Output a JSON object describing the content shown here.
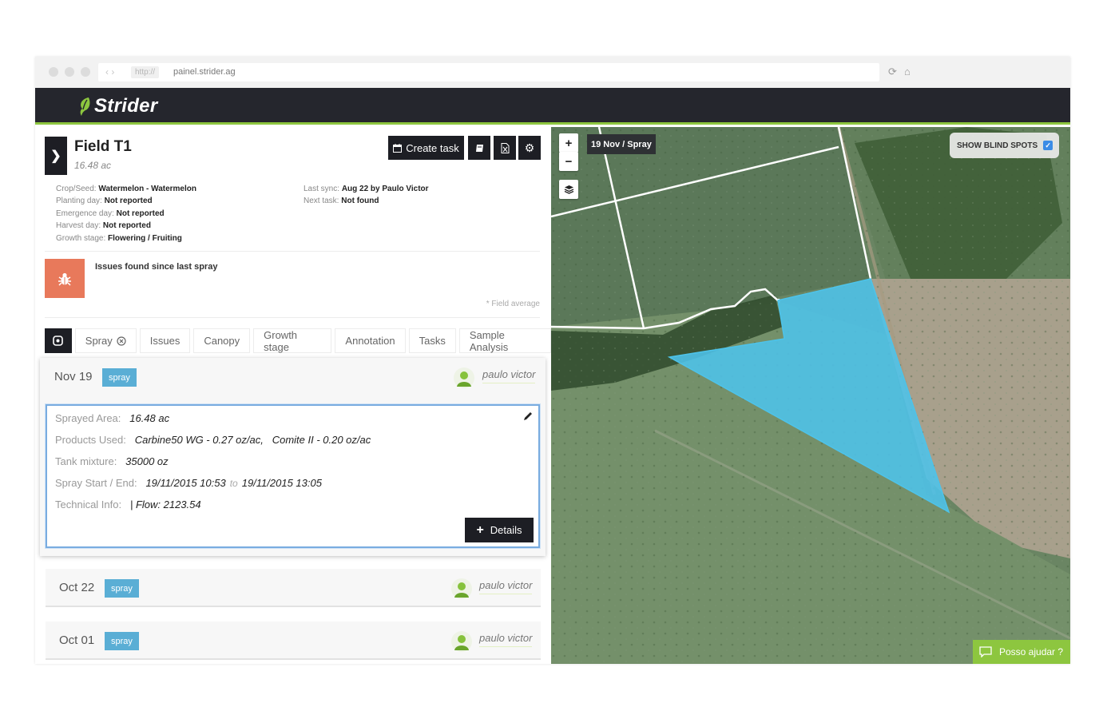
{
  "browser": {
    "url_protocol": "http://",
    "url": "painel.strider.ag"
  },
  "app": {
    "brand": "Strider",
    "brand_color": "#8dc63f",
    "dark": "#1d1e24"
  },
  "field": {
    "title": "Field T1",
    "area": "16.48 ac",
    "toolbar": {
      "create_task_label": "Create task",
      "icons": [
        "calendar-icon",
        "book-icon",
        "excel-icon",
        "gear-icon"
      ]
    },
    "info_left": [
      {
        "label": "Crop/Seed:",
        "value": "Watermelon - Watermelon",
        "status": "normal"
      },
      {
        "label": "Planting day:",
        "value": "Not reported",
        "status": "missing"
      },
      {
        "label": "Emergence day:",
        "value": "Not reported",
        "status": "missing"
      },
      {
        "label": "Harvest day:",
        "value": "Not reported",
        "status": "missing"
      },
      {
        "label": "Growth stage:",
        "value": "Flowering / Fruiting",
        "status": "normal"
      }
    ],
    "info_right": [
      {
        "label": "Last sync:",
        "value": "Aug 22 by Paulo Victor"
      },
      {
        "label": "Next task:",
        "value": "Not found"
      }
    ],
    "issues_title": "Issues found since last spray",
    "field_average_note": "* Field average"
  },
  "tabs": [
    {
      "label": "Spray",
      "active": true,
      "closable": true
    },
    {
      "label": "Issues"
    },
    {
      "label": "Canopy"
    },
    {
      "label": "Growth stage"
    },
    {
      "label": "Annotation"
    },
    {
      "label": "Tasks"
    },
    {
      "label": "Sample Analysis"
    }
  ],
  "events": [
    {
      "date": "Nov 19",
      "tag": "spray",
      "user": "paulo victor",
      "details": {
        "sprayed_area_label": "Sprayed Area:",
        "sprayed_area": "16.48 ac",
        "products_label": "Products Used:",
        "product_1": "Carbine50 WG - 0.27 oz/ac,",
        "product_2": "Comite II - 0.20 oz/ac",
        "tank_label": "Tank mixture:",
        "tank": "35000 oz",
        "spray_label": "Spray Start / End:",
        "start": "19/11/2015 10:53",
        "to": "to",
        "end": "19/11/2015 13:05",
        "tech_label": "Technical Info:",
        "tech": "| Flow: 2123.54",
        "details_button": "Details"
      }
    },
    {
      "date": "Oct 22",
      "tag": "spray",
      "user": "paulo victor"
    },
    {
      "date": "Oct 01",
      "tag": "spray",
      "user": "paulo victor"
    }
  ],
  "map": {
    "zoom_in": "+",
    "zoom_out": "−",
    "date_label": "19 Nov / Spray",
    "blind_spots_label": "SHOW BLIND SPOTS",
    "blind_spots_checked": true,
    "help_label": "Posso ajudar ?",
    "polygon_color": "#4dc3ea"
  }
}
